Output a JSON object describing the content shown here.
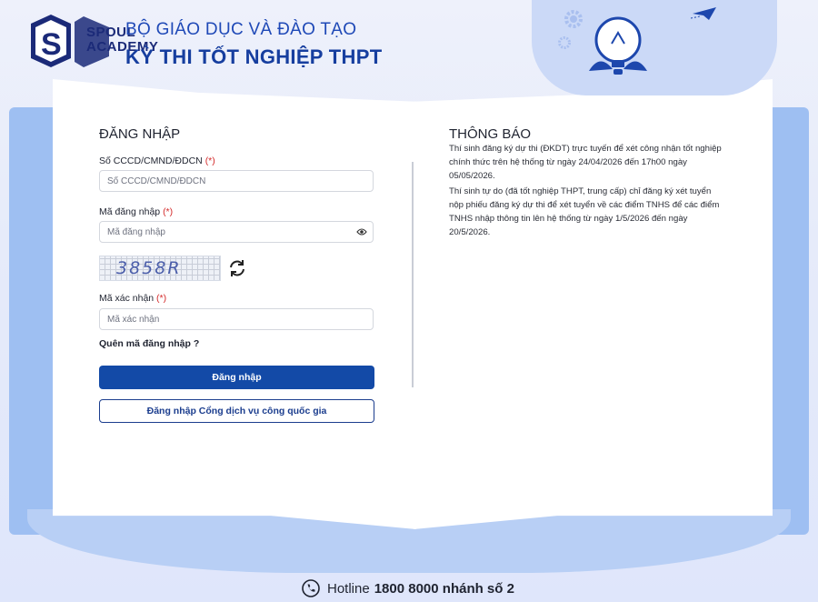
{
  "header": {
    "logo_text_line1": "SPOUL",
    "logo_text_line2": "ACADEMY",
    "ministry": "BỘ GIÁO DỤC VÀ ĐÀO TẠO",
    "exam": "KỲ THI TỐT NGHIỆP THPT"
  },
  "login": {
    "title": "ĐĂNG NHẬP",
    "id_label": "Số CCCD/CMND/ĐDCN",
    "id_required": "(*)",
    "id_placeholder": "Số CCCD/CMND/ĐDCN",
    "password_label": "Mã đăng nhập",
    "password_required": "(*)",
    "password_placeholder": "Mã đăng nhập",
    "captcha_text": "3858R",
    "captcha_label": "Mã xác nhận",
    "captcha_required": "(*)",
    "captcha_placeholder": "Mã xác nhận",
    "forgot_link": "Quên mã đăng nhập ?",
    "login_button": "Đăng nhập",
    "national_portal_button": "Đăng nhập Cổng dịch vụ công quốc gia"
  },
  "notice": {
    "title": "THÔNG BÁO",
    "paragraphs": [
      "Thí sinh đăng ký dự thi (ĐKDT) trực tuyến để xét công nhận tốt nghiệp chính thức trên hệ thống từ ngày 24/04/2026 đến 17h00 ngày 05/05/2026.",
      "Thí sinh tự do (đã tốt nghiệp THPT, trung cấp) chỉ đăng ký xét tuyển nộp phiếu đăng ký dự thi để xét tuyển về các điểm TNHS để các điểm TNHS nhập thông tin lên hệ thống từ ngày 1/5/2026 đến ngày 20/5/2026."
    ]
  },
  "footer": {
    "hotline_label": "Hotline",
    "hotline_number": "1800 8000 nhánh số 2"
  },
  "colors": {
    "primary": "#134aa7",
    "heading_blue": "#1f49b7",
    "required_red": "#d42b2b",
    "book_blue": "#9ebff2"
  },
  "icons": [
    "logo-s-icon",
    "lightbulb-icon",
    "gear-icon",
    "paper-plane-icon",
    "eye-icon",
    "refresh-icon",
    "phone-icon"
  ]
}
